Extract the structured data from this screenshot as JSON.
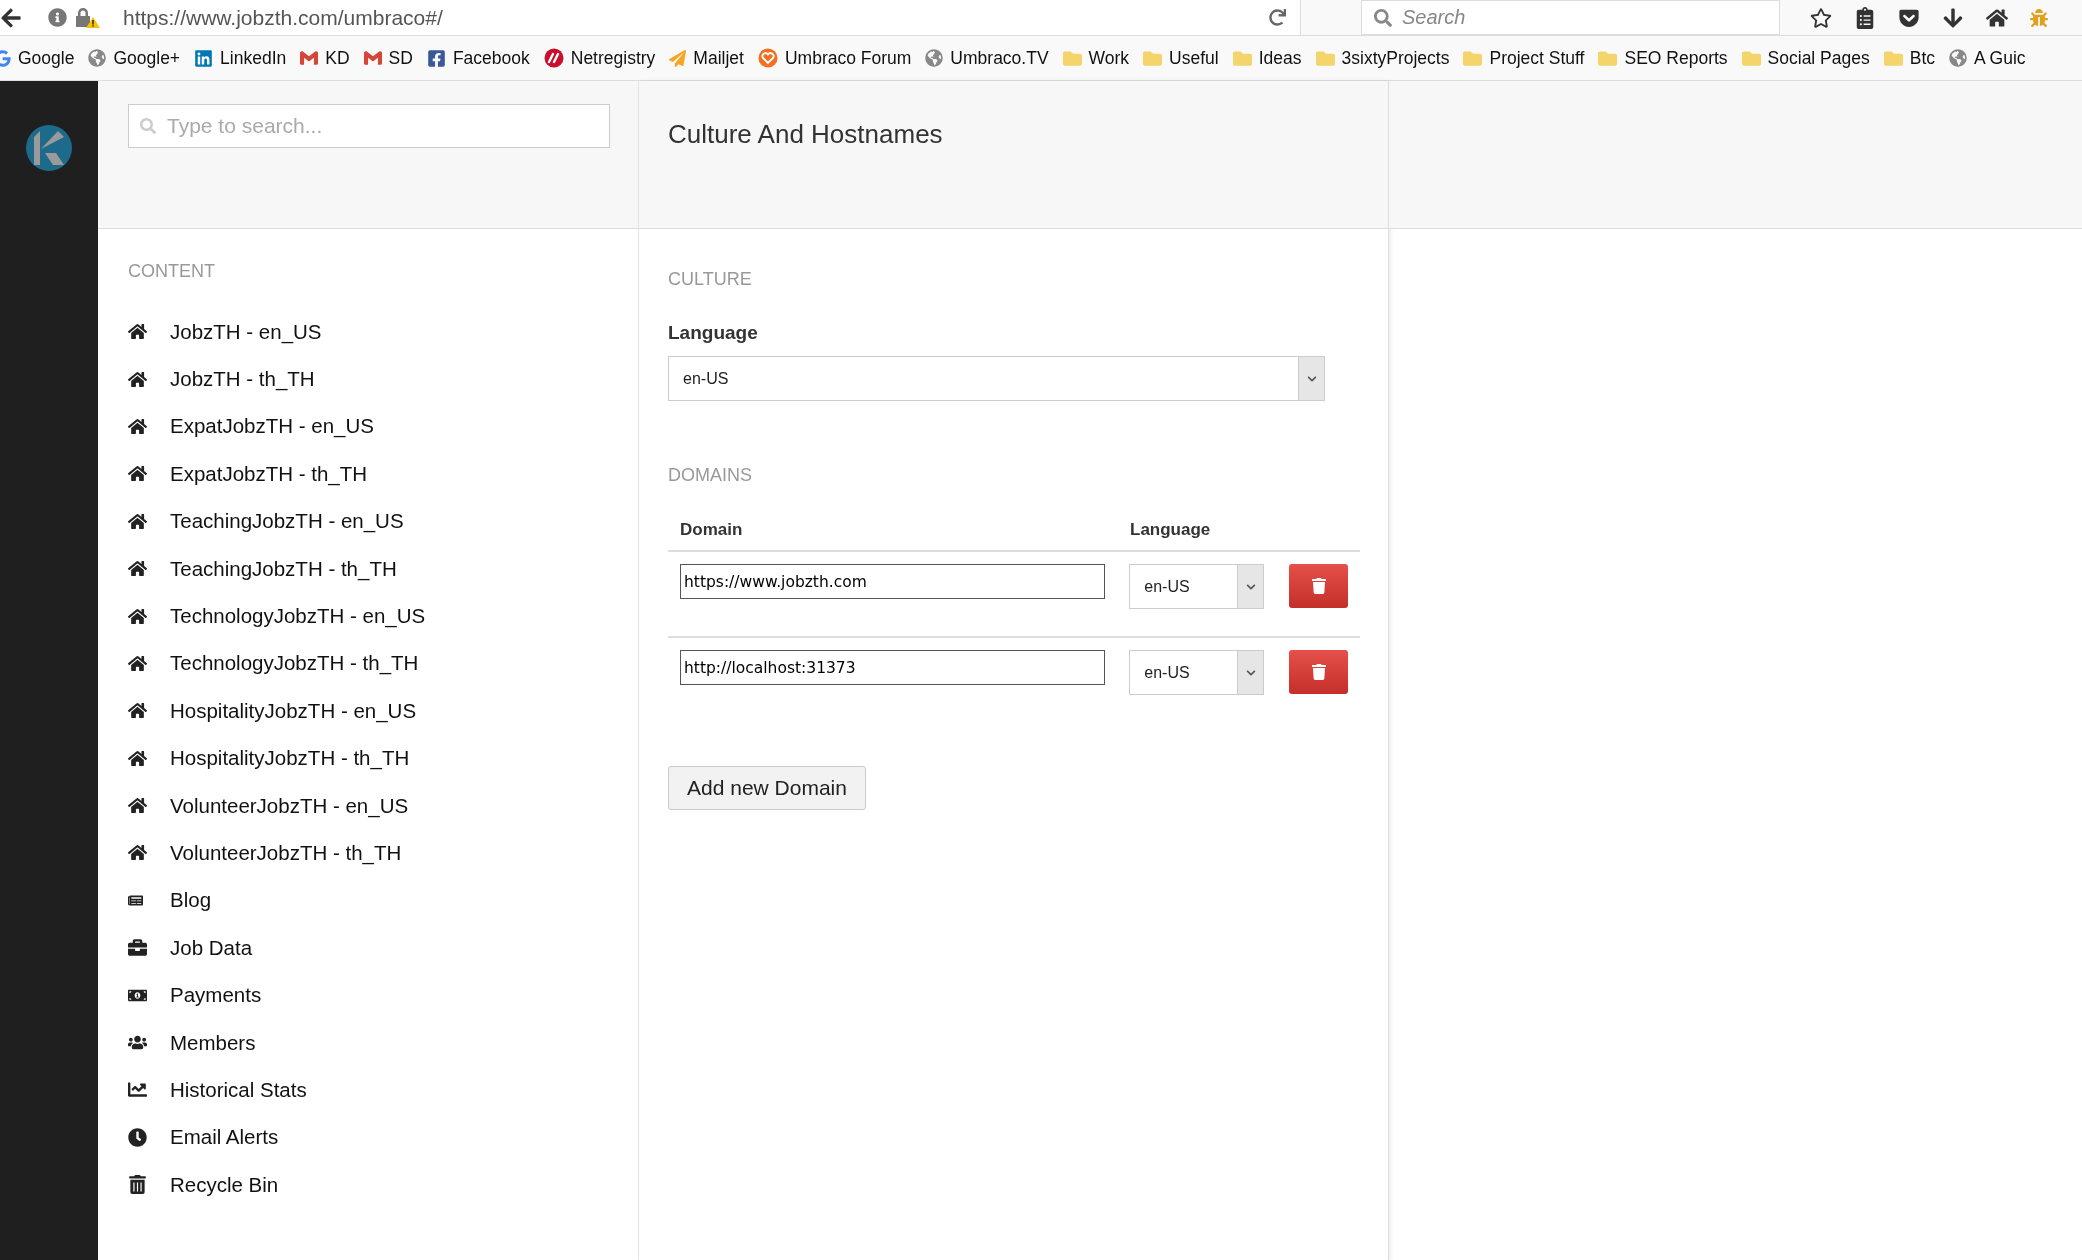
{
  "browser": {
    "url": "https://www.jobzth.com/umbraco#/",
    "search_placeholder": "Search"
  },
  "bookmarks": [
    {
      "label": "Google",
      "kind": "google"
    },
    {
      "label": "Google+",
      "kind": "globe"
    },
    {
      "label": "LinkedIn",
      "kind": "linkedin"
    },
    {
      "label": "KD",
      "kind": "mail"
    },
    {
      "label": "SD",
      "kind": "mail"
    },
    {
      "label": "Facebook",
      "kind": "facebook"
    },
    {
      "label": "Netregistry",
      "kind": "netregistry"
    },
    {
      "label": "Mailjet",
      "kind": "plane"
    },
    {
      "label": "Umbraco Forum",
      "kind": "heart"
    },
    {
      "label": "Umbraco.TV",
      "kind": "globe"
    },
    {
      "label": "Work",
      "kind": "folder"
    },
    {
      "label": "Useful",
      "kind": "folder"
    },
    {
      "label": "Ideas",
      "kind": "folder"
    },
    {
      "label": "3sixtyProjects",
      "kind": "folder"
    },
    {
      "label": "Project Stuff",
      "kind": "folder"
    },
    {
      "label": "SEO Reports",
      "kind": "folder"
    },
    {
      "label": "Social Pages",
      "kind": "folder"
    },
    {
      "label": "Btc",
      "kind": "folder"
    },
    {
      "label": "A Guic",
      "kind": "globe"
    }
  ],
  "search": {
    "placeholder": "Type to search..."
  },
  "tree": {
    "heading": "CONTENT",
    "items": [
      {
        "label": "JobzTH - en_US",
        "kind": "home"
      },
      {
        "label": "JobzTH - th_TH",
        "kind": "home"
      },
      {
        "label": "ExpatJobzTH - en_US",
        "kind": "home"
      },
      {
        "label": "ExpatJobzTH - th_TH",
        "kind": "home"
      },
      {
        "label": "TeachingJobzTH - en_US",
        "kind": "home"
      },
      {
        "label": "TeachingJobzTH - th_TH",
        "kind": "home"
      },
      {
        "label": "TechnologyJobzTH - en_US",
        "kind": "home"
      },
      {
        "label": "TechnologyJobzTH - th_TH",
        "kind": "home"
      },
      {
        "label": "HospitalityJobzTH - en_US",
        "kind": "home"
      },
      {
        "label": "HospitalityJobzTH - th_TH",
        "kind": "home"
      },
      {
        "label": "VolunteerJobzTH - en_US",
        "kind": "home"
      },
      {
        "label": "VolunteerJobzTH - th_TH",
        "kind": "home"
      },
      {
        "label": "Blog",
        "kind": "newspaper"
      },
      {
        "label": "Job Data",
        "kind": "briefcase"
      },
      {
        "label": "Payments",
        "kind": "money"
      },
      {
        "label": "Members",
        "kind": "users"
      },
      {
        "label": "Historical Stats",
        "kind": "chart"
      },
      {
        "label": "Email Alerts",
        "kind": "alarm"
      },
      {
        "label": "Recycle Bin",
        "kind": "trash"
      }
    ]
  },
  "editor": {
    "title": "Culture And Hostnames",
    "culture": {
      "heading": "CULTURE",
      "label": "Language",
      "value": "en-US"
    },
    "domains": {
      "heading": "DOMAINS",
      "columns": [
        "Domain",
        "Language"
      ],
      "rows": [
        {
          "domain": "https://www.jobzth.com",
          "language": "en-US"
        },
        {
          "domain": "http://localhost:31373",
          "language": "en-US"
        }
      ],
      "add_button": "Add new Domain"
    }
  }
}
